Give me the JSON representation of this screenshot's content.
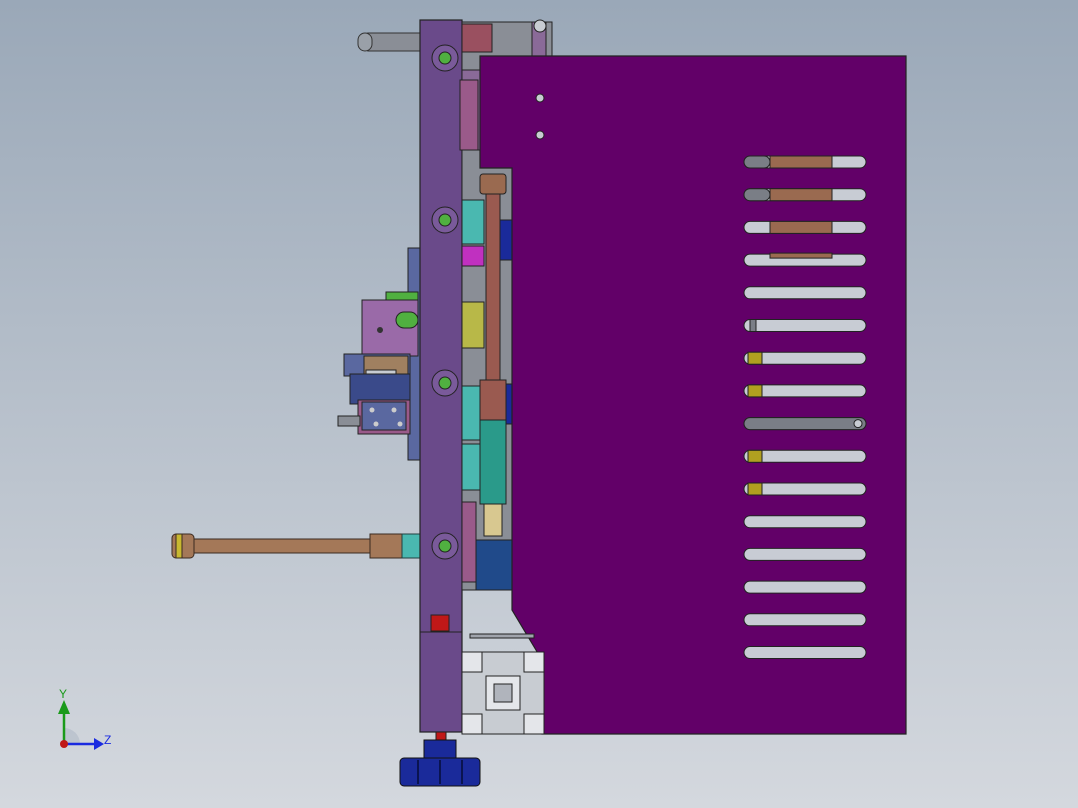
{
  "viewport": {
    "background_top": "#9aa8b8",
    "background_bottom": "#d4d8de"
  },
  "colors": {
    "purple_panel": "#620068",
    "violet_plate": "#6a4a8a",
    "violet_plate_dark": "#3f2c5a",
    "mauve": "#9a5a8a",
    "brown_rod": "#9a6a50",
    "tan_rod": "#a47858",
    "teal": "#2a9a8a",
    "cyan_block": "#3ab0a8",
    "olive": "#b0a020",
    "yellow_green": "#b8b848",
    "green": "#50b040",
    "navy": "#1a2a9a",
    "red": "#c01818",
    "gray": "#7a7e86",
    "light_gray": "#c8ccd2",
    "slot_fill": "#c8ccd4",
    "magenta": "#c030c0",
    "blue_block": "#204a8a"
  },
  "triad": {
    "y_label": "Y",
    "z_label": "Z",
    "y_color": "#1a9a1a",
    "z_color": "#1a2ae0",
    "origin_color": "#c01818"
  },
  "slots": [
    {
      "insert": "gray-brown"
    },
    {
      "insert": "gray-brown"
    },
    {
      "insert": "brown"
    },
    {
      "insert": "brown-under"
    },
    {
      "insert": "none"
    },
    {
      "insert": "small-gray"
    },
    {
      "insert": "olive"
    },
    {
      "insert": "olive"
    },
    {
      "insert": "gray-full"
    },
    {
      "insert": "olive"
    },
    {
      "insert": "olive"
    },
    {
      "insert": "none"
    },
    {
      "insert": "none"
    },
    {
      "insert": "none"
    },
    {
      "insert": "none"
    },
    {
      "insert": "none"
    }
  ]
}
